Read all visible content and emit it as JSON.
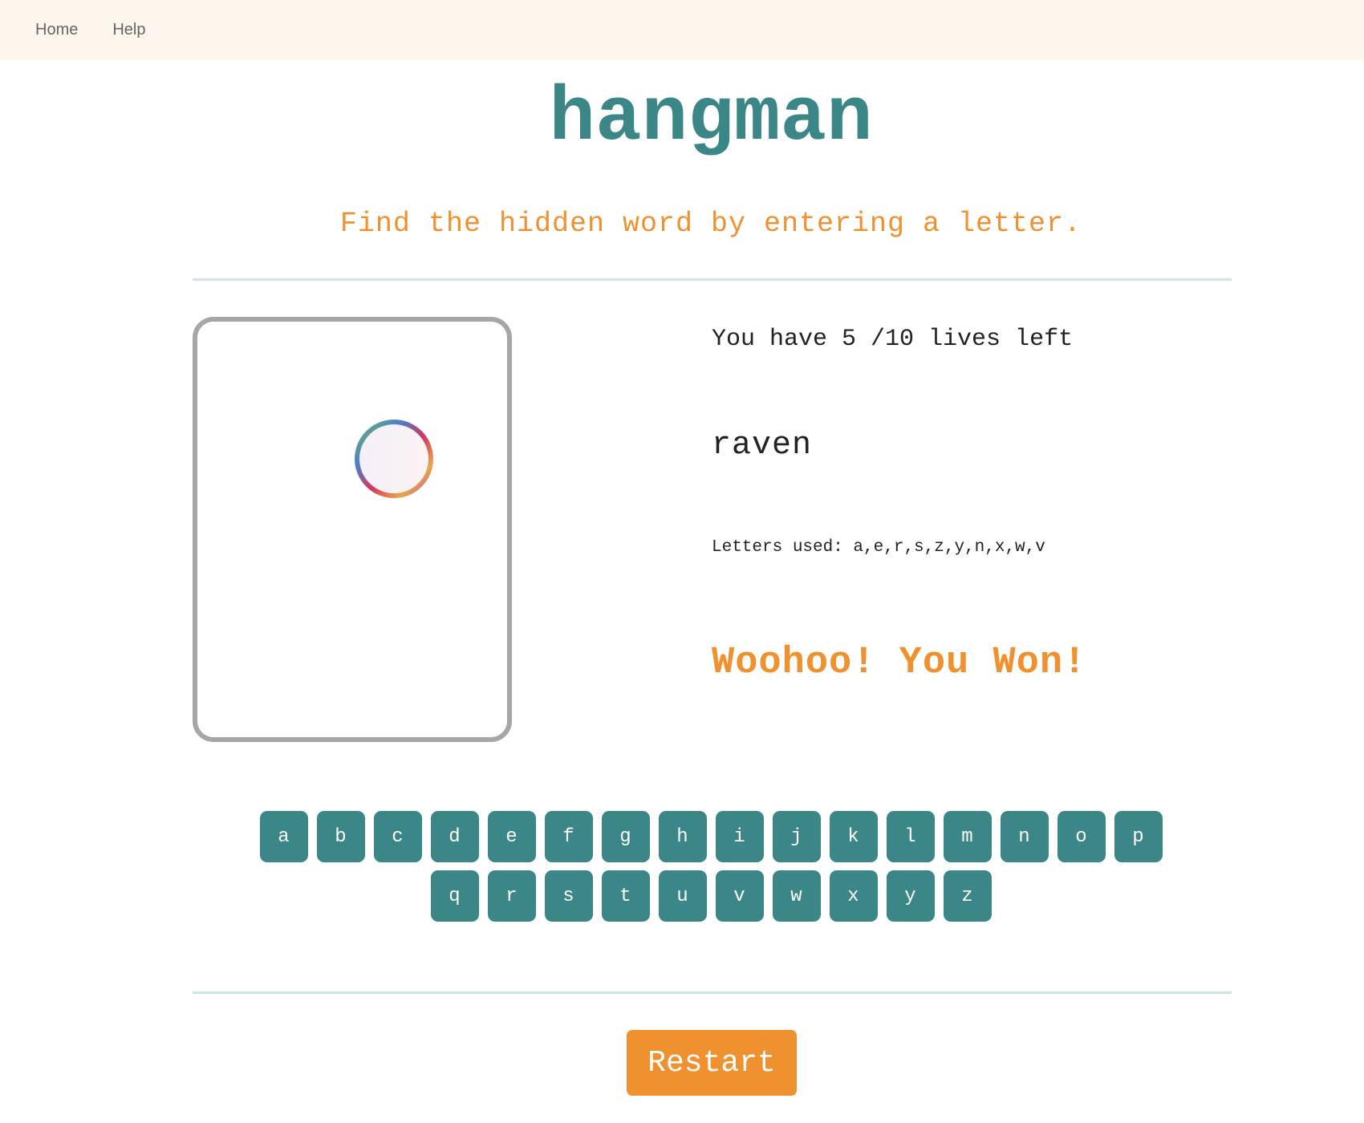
{
  "nav": {
    "home_label": "Home",
    "help_label": "Help"
  },
  "game": {
    "title": "hangman",
    "instructions": "Find the hidden word by entering a letter.",
    "lives_text": "You have 5 /10 lives left",
    "lives_remaining": 5,
    "lives_total": 10,
    "word": "raven",
    "letters_used_text": "Letters used: a,e,r,s,z,y,n,x,w,v",
    "result_text": "Woohoo! You Won!"
  },
  "keyboard": {
    "row1": [
      "a",
      "b",
      "c",
      "d",
      "e",
      "f",
      "g",
      "h",
      "i",
      "j",
      "k",
      "l",
      "m",
      "n",
      "o",
      "p"
    ],
    "row2": [
      "q",
      "r",
      "s",
      "t",
      "u",
      "v",
      "w",
      "x",
      "y",
      "z"
    ]
  },
  "restart_label": "Restart",
  "colors": {
    "accent_teal": "#3b8686",
    "accent_orange": "#f0912f",
    "nav_bg": "#fdf6ec",
    "divider": "#d3e4e6"
  }
}
